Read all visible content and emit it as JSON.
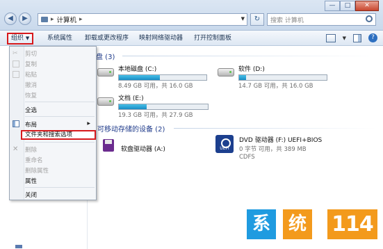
{
  "window": {
    "address": {
      "crumb": "计算机"
    },
    "search_placeholder": "搜索 计算机",
    "controls": {
      "minimize": "—",
      "maximize": "□",
      "close": "✕"
    }
  },
  "commandbar": {
    "organize": "组织",
    "system_properties": "系统属性",
    "uninstall": "卸载或更改程序",
    "map_drive": "映射网络驱动器",
    "control_panel": "打开控制面板"
  },
  "sections": {
    "hdd_title": "盘 (3)",
    "removable_title": "可移动存储的设备 (2)"
  },
  "drives": [
    {
      "name": "本地磁盘 (C:)",
      "info": "8.49 GB 可用，共 16.0 GB",
      "used_fraction": 0.47
    },
    {
      "name": "软件 (D:)",
      "info": "14.7 GB 可用，共 16.0 GB",
      "used_fraction": 0.08
    },
    {
      "name": "文档 (E:)",
      "info": "19.3 GB 可用，共 27.9 GB",
      "used_fraction": 0.31
    }
  ],
  "removable": [
    {
      "name": "软盘驱动器 (A:)"
    },
    {
      "name": "DVD 驱动器 (F:) UEFI+BIOS",
      "info": "0 字节 可用，共 389 MB",
      "fs": "CDFS"
    }
  ],
  "menu": {
    "items": [
      {
        "label": "剪切",
        "enabled": false
      },
      {
        "label": "复制",
        "enabled": false
      },
      {
        "label": "粘贴",
        "enabled": false
      },
      {
        "label": "撤消",
        "enabled": false
      },
      {
        "label": "恢复",
        "enabled": false
      },
      {
        "label": "全选",
        "enabled": true
      },
      {
        "label": "布局",
        "enabled": true
      },
      {
        "label": "文件夹和搜索选项",
        "enabled": true
      },
      {
        "label": "删除",
        "enabled": false
      },
      {
        "label": "重命名",
        "enabled": false
      },
      {
        "label": "删除属性",
        "enabled": false
      },
      {
        "label": "属性",
        "enabled": true
      },
      {
        "label": "关闭",
        "enabled": true
      }
    ]
  },
  "watermark": {
    "a": "系",
    "b": "统",
    "c": "114"
  },
  "colors": {
    "highlight_border": "#d7191c",
    "progress_fill": "#1a8cc4",
    "section_title": "#1e3a8a"
  }
}
